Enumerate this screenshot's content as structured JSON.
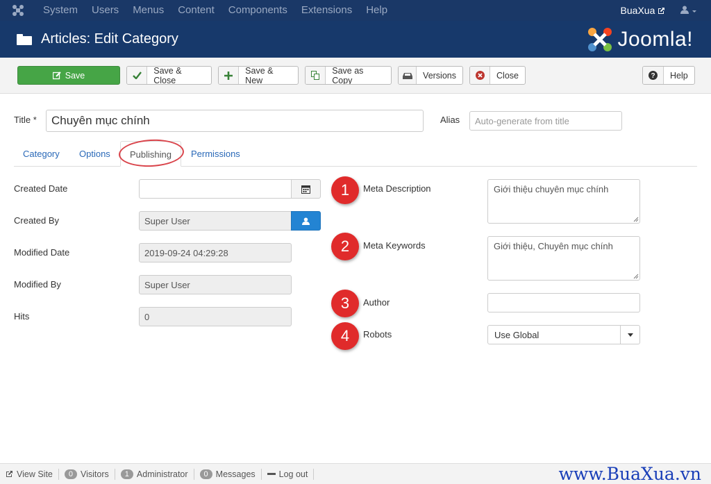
{
  "topnav": {
    "menu": [
      "System",
      "Users",
      "Menus",
      "Content",
      "Components",
      "Extensions",
      "Help"
    ],
    "site_name": "BuaXua"
  },
  "header": {
    "title": "Articles: Edit Category",
    "brand": "Joomla!"
  },
  "toolbar": {
    "save": "Save",
    "save_close": "Save & Close",
    "save_new": "Save & New",
    "save_copy": "Save as Copy",
    "versions": "Versions",
    "close": "Close",
    "help": "Help"
  },
  "form": {
    "title_label": "Title *",
    "title_value": "Chuyên mục chính",
    "alias_label": "Alias",
    "alias_placeholder": "Auto-generate from title"
  },
  "tabs": [
    "Category",
    "Options",
    "Publishing",
    "Permissions"
  ],
  "publishing": {
    "created_date_label": "Created Date",
    "created_date_value": "",
    "created_by_label": "Created By",
    "created_by_value": "Super User",
    "modified_date_label": "Modified Date",
    "modified_date_value": "2019-09-24 04:29:28",
    "modified_by_label": "Modified By",
    "modified_by_value": "Super User",
    "hits_label": "Hits",
    "hits_value": "0"
  },
  "metadata": {
    "meta_description_label": "Meta Description",
    "meta_description_value": "Giới thiệu chuyên mục chính",
    "meta_keywords_label": "Meta Keywords",
    "meta_keywords_value": "Giới thiệu, Chuyên mục chính",
    "author_label": "Author",
    "author_value": "",
    "robots_label": "Robots",
    "robots_value": "Use Global"
  },
  "markers": [
    "1",
    "2",
    "3",
    "4"
  ],
  "status": {
    "view_site": "View Site",
    "visitors_count": "0",
    "visitors": "Visitors",
    "admin_count": "1",
    "admin": "Administrator",
    "messages_count": "0",
    "messages": "Messages",
    "logout": "Log out",
    "watermark": "www.BuaXua.vn"
  },
  "colors": {
    "nav": "#1a3867",
    "header": "#17396b",
    "save": "#46a546",
    "link": "#2a69b8",
    "marker": "#e02b2b"
  }
}
